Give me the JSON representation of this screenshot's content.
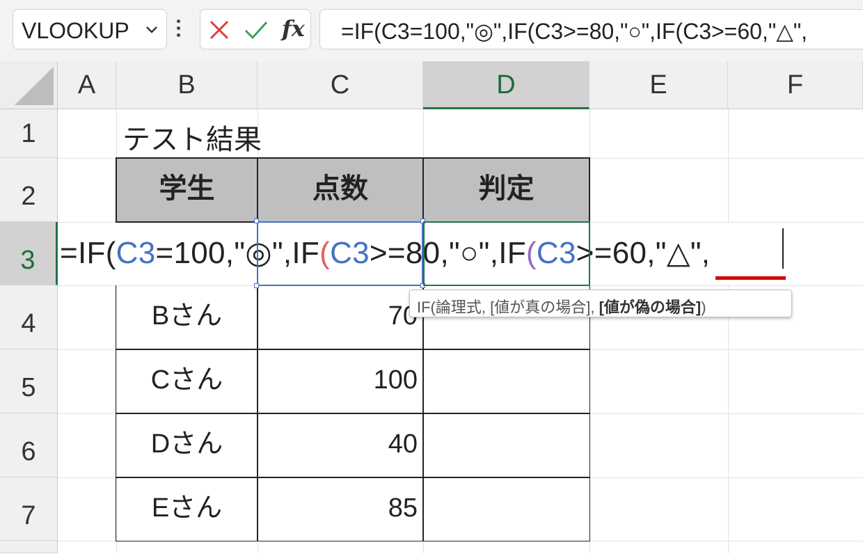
{
  "name_box": {
    "value": "VLOOKUP"
  },
  "formula_bar": {
    "cancel_icon": "x-icon",
    "enter_icon": "check-icon",
    "fx_label": "fx",
    "formula": "=IF(C3=100,\"◎\",IF(C3>=80,\"○\",IF(C3>=60,\"△\","
  },
  "columns": [
    "A",
    "B",
    "C",
    "D",
    "E",
    "F"
  ],
  "rows": [
    "1",
    "2",
    "3",
    "4",
    "5",
    "6",
    "7"
  ],
  "sheet": {
    "title": "テスト結果",
    "headers": {
      "student": "学生",
      "score": "点数",
      "judgment": "判定"
    },
    "records": [
      {
        "student": "Bさん",
        "score": "70"
      },
      {
        "student": "Cさん",
        "score": "100"
      },
      {
        "student": "Dさん",
        "score": "40"
      },
      {
        "student": "Eさん",
        "score": "85"
      }
    ]
  },
  "edit_cell": {
    "p1": "=IF(",
    "p2": "C3",
    "p3": "=100,\"◎\",IF",
    "p4": "(",
    "p5": "C3",
    "p6": ">=80,\"○\",IF",
    "p7": "(",
    "p8": "C3",
    "p9": ">=60,\"△\","
  },
  "tooltip": {
    "prefix": "IF(論理式, [値が真の場合], ",
    "bold_arg": "[値が偽の場合]",
    "suffix": ")"
  },
  "colors": {
    "ref_blue": "#4472c4",
    "ref_red": "#e06060",
    "ref_purple": "#8e6bc8",
    "excel_green": "#217346",
    "underline_red": "#d40000"
  }
}
